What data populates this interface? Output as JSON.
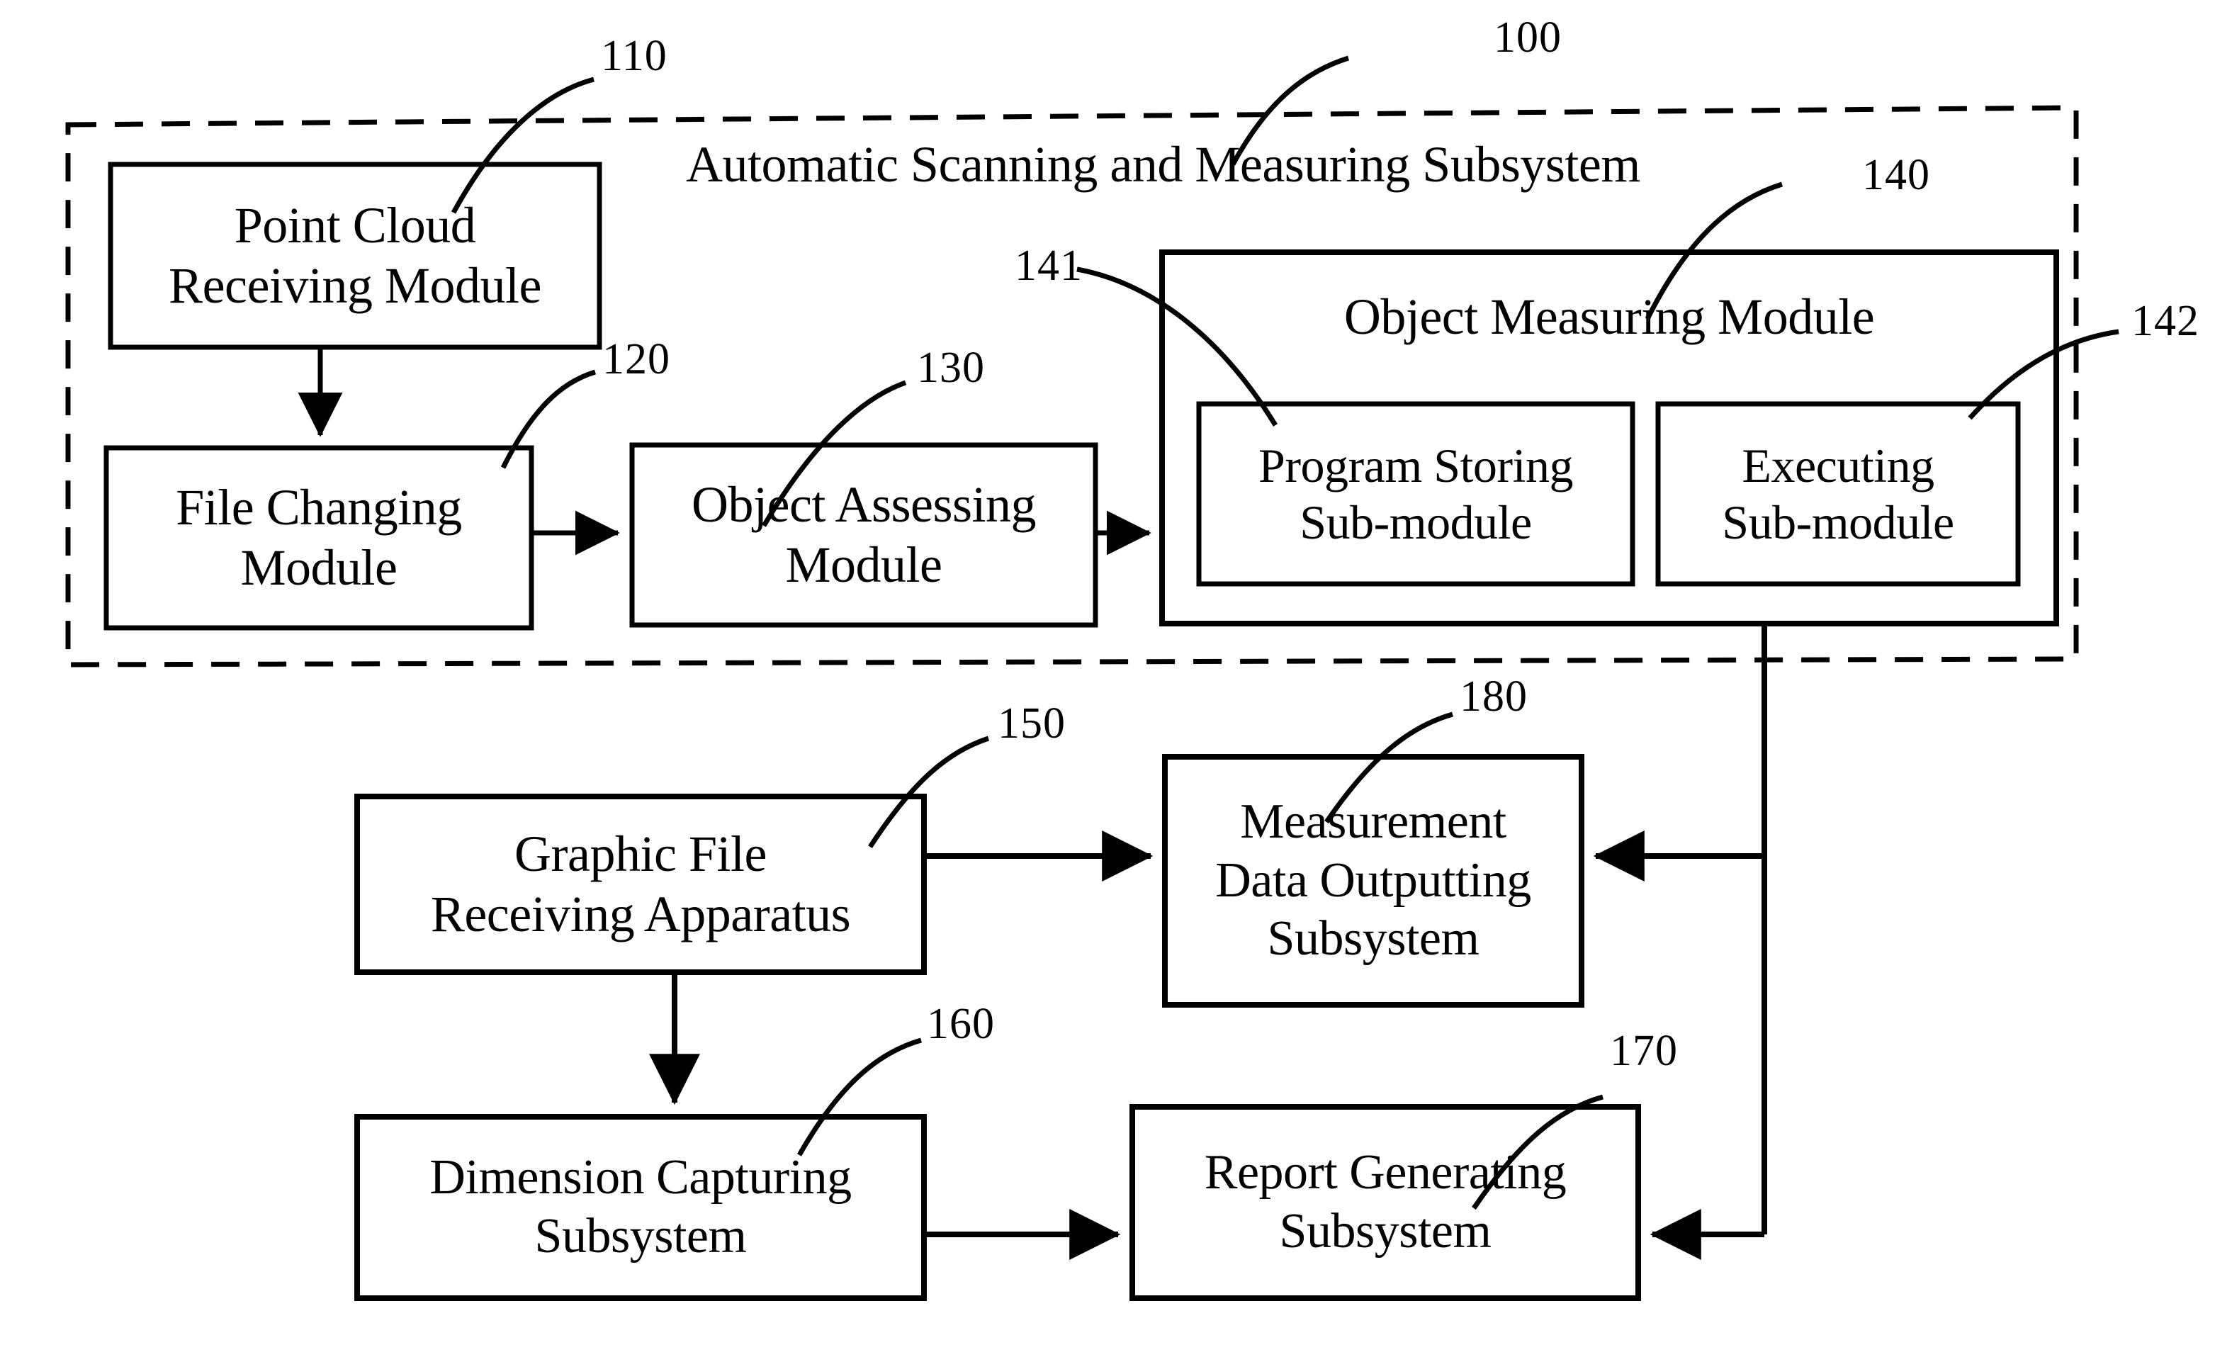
{
  "figure": {
    "type": "patent-block-diagram",
    "background_color": "#ffffff",
    "line_color": "#000000"
  },
  "subsystem": {
    "ref": "100",
    "title": "Automatic Scanning and Measuring Subsystem",
    "boundary_style": "dashed"
  },
  "nodes": {
    "point_cloud_receiving_module": {
      "ref": "110",
      "label": "Point Cloud\nReceiving Module"
    },
    "file_changing_module": {
      "ref": "120",
      "label": "File Changing\nModule"
    },
    "object_assessing_module": {
      "ref": "130",
      "label": "Object Assessing\nModule"
    },
    "object_measuring_module": {
      "ref": "140",
      "label": "Object Measuring Module"
    },
    "program_storing_sub_module": {
      "ref": "141",
      "label": "Program Storing\nSub-module"
    },
    "executing_sub_module": {
      "ref": "142",
      "label": "Executing\nSub-module"
    },
    "graphic_file_receiving_apparatus": {
      "ref": "150",
      "label": "Graphic File\nReceiving Apparatus"
    },
    "dimension_capturing_subsystem": {
      "ref": "160",
      "label": "Dimension Capturing\nSubsystem"
    },
    "report_generating_subsystem": {
      "ref": "170",
      "label": "Report Generating\nSubsystem"
    },
    "measurement_data_outputting_subsystem": {
      "ref": "180",
      "label": "Measurement\nData Outputting\nSubsystem"
    }
  }
}
